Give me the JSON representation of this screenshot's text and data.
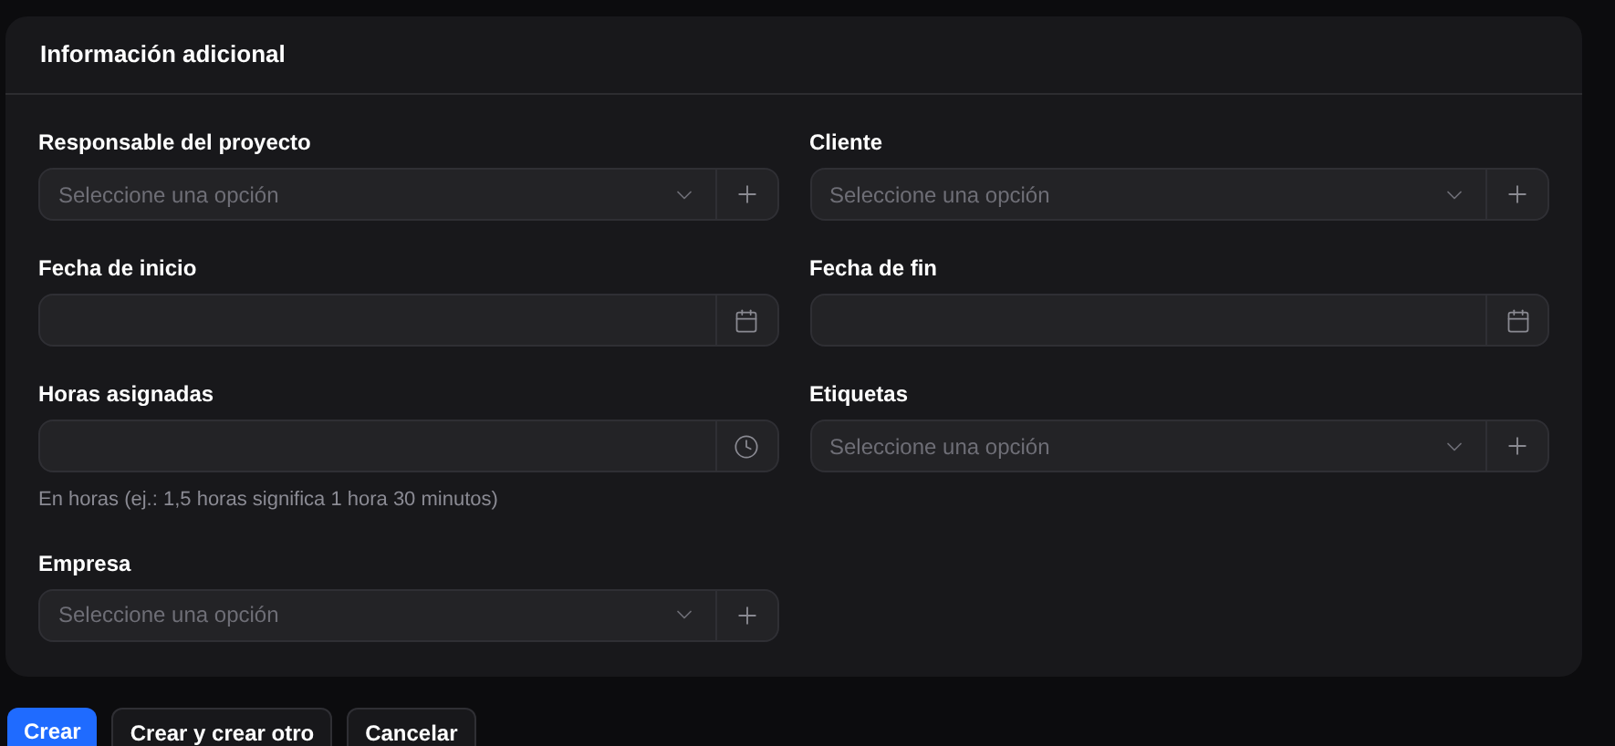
{
  "section": {
    "title": "Información adicional"
  },
  "fields": [
    {
      "label": "Responsable del proyecto",
      "kind": "select",
      "placeholder": "Seleccione una opción"
    },
    {
      "label": "Cliente",
      "kind": "select",
      "placeholder": "Seleccione una opción"
    },
    {
      "label": "Fecha de inicio",
      "kind": "date"
    },
    {
      "label": "Fecha de fin",
      "kind": "date"
    },
    {
      "label": "Horas asignadas",
      "kind": "time",
      "helper": "En horas (ej.: 1,5 horas significa 1 hora 30 minutos)"
    },
    {
      "label": "Etiquetas",
      "kind": "select",
      "placeholder": "Seleccione una opción"
    },
    {
      "label": "Empresa",
      "kind": "select",
      "placeholder": "Seleccione una opción"
    }
  ],
  "buttons": [
    {
      "label": "Crear",
      "kind": "primary"
    },
    {
      "label": "Crear y crear otro",
      "kind": "secondary"
    },
    {
      "label": "Cancelar",
      "kind": "secondary"
    }
  ]
}
